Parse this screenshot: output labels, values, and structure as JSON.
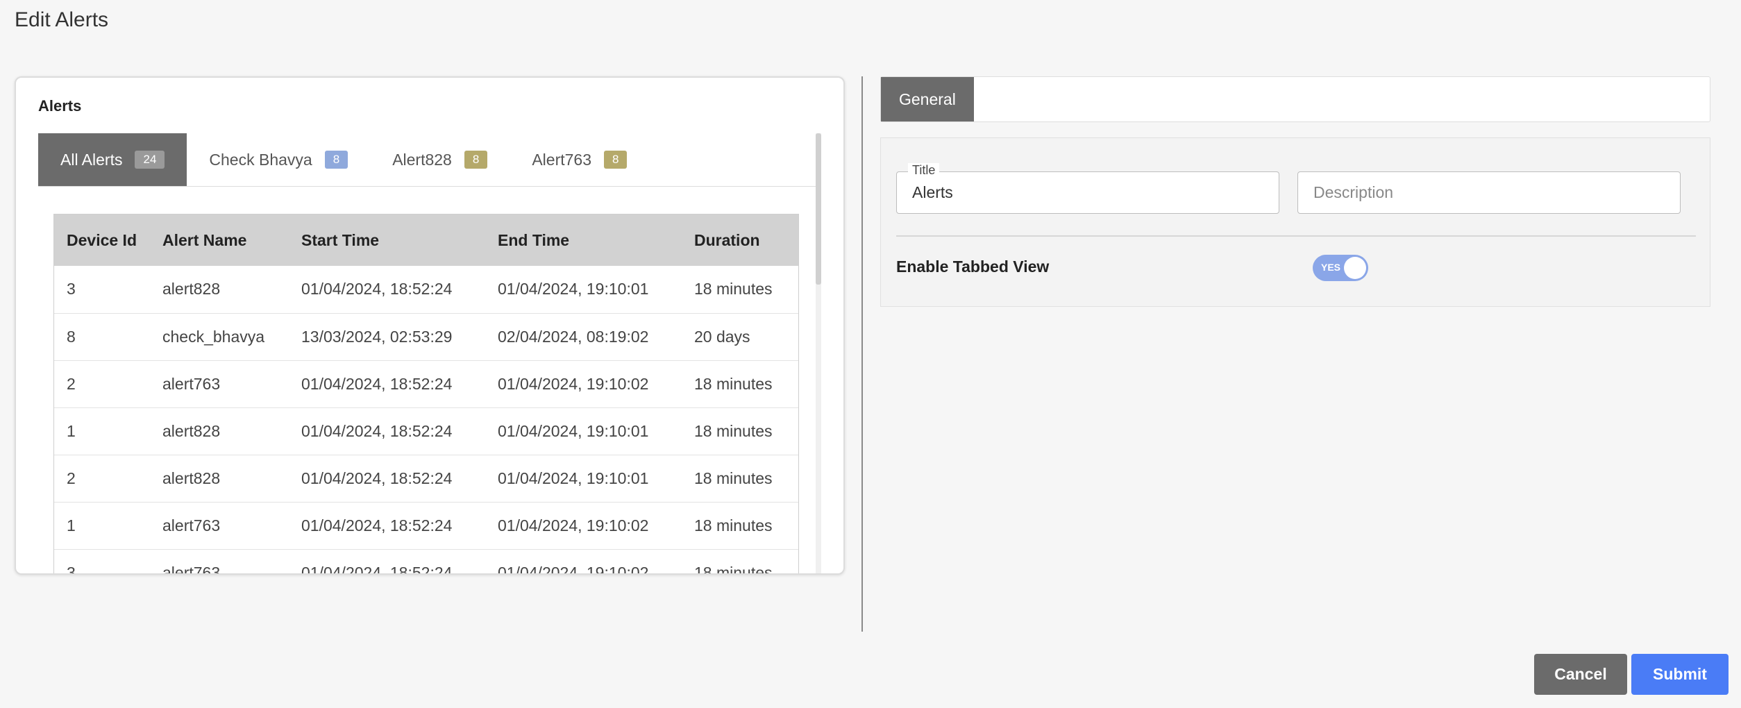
{
  "page": {
    "title": "Edit Alerts"
  },
  "preview": {
    "card_title": "Alerts",
    "tabs": [
      {
        "label": "All Alerts",
        "count": "24",
        "badge_color": "#9a9a9a"
      },
      {
        "label": "Check Bhavya",
        "count": "8",
        "badge_color": "#8fa9dc"
      },
      {
        "label": "Alert828",
        "count": "8",
        "badge_color": "#b5a96a"
      },
      {
        "label": "Alert763",
        "count": "8",
        "badge_color": "#b5a96a"
      }
    ],
    "table": {
      "columns": [
        "Device Id",
        "Alert Name",
        "Start Time",
        "End Time",
        "Duration"
      ],
      "rows": [
        [
          "3",
          "alert828",
          "01/04/2024, 18:52:24",
          "01/04/2024, 19:10:01",
          "18 minutes"
        ],
        [
          "8",
          "check_bhavya",
          "13/03/2024, 02:53:29",
          "02/04/2024, 08:19:02",
          "20 days"
        ],
        [
          "2",
          "alert763",
          "01/04/2024, 18:52:24",
          "01/04/2024, 19:10:02",
          "18 minutes"
        ],
        [
          "1",
          "alert828",
          "01/04/2024, 18:52:24",
          "01/04/2024, 19:10:01",
          "18 minutes"
        ],
        [
          "2",
          "alert828",
          "01/04/2024, 18:52:24",
          "01/04/2024, 19:10:01",
          "18 minutes"
        ],
        [
          "1",
          "alert763",
          "01/04/2024, 18:52:24",
          "01/04/2024, 19:10:02",
          "18 minutes"
        ],
        [
          "3",
          "alert763",
          "01/04/2024, 18:52:24",
          "01/04/2024, 19:10:02",
          "18 minutes"
        ]
      ]
    }
  },
  "settings": {
    "tab_label": "General",
    "title_field": {
      "label": "Title",
      "value": "Alerts"
    },
    "description_field": {
      "placeholder": "Description"
    },
    "tabbed_view": {
      "label": "Enable Tabbed View",
      "state_text": "YES",
      "enabled": true
    }
  },
  "actions": {
    "cancel": "Cancel",
    "submit": "Submit"
  },
  "colors": {
    "accent": "#4a7cf6",
    "toggle_on": "#8aa6e8",
    "tab_active": "#6b6b6b"
  }
}
